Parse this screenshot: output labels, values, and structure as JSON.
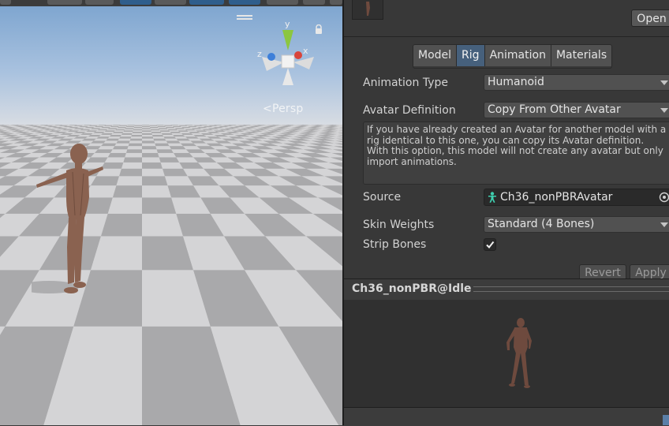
{
  "scene": {
    "camera_mode": "Persp",
    "gizmo_axes": {
      "y": "y",
      "x": "x",
      "z": "z"
    },
    "colors": {
      "axis_x": "#d9443a",
      "axis_y": "#8cc63f",
      "axis_z": "#3d7fd9"
    }
  },
  "inspector": {
    "open_button": "Open",
    "tabs": [
      {
        "label": "Model",
        "active": false
      },
      {
        "label": "Rig",
        "active": true
      },
      {
        "label": "Animation",
        "active": false
      },
      {
        "label": "Materials",
        "active": false
      }
    ],
    "animation_type": {
      "label": "Animation Type",
      "value": "Humanoid"
    },
    "avatar_definition": {
      "label": "Avatar Definition",
      "value": "Copy From Other Avatar"
    },
    "help_text": "If you have already created an Avatar for another model with a rig identical to this one, you can copy its Avatar definition.\nWith this option, this model will not create any avatar but only import animations.",
    "source": {
      "label": "Source",
      "value": "Ch36_nonPBRAvatar",
      "icon": "avatar-icon"
    },
    "skin_weights": {
      "label": "Skin Weights",
      "value": "Standard (4 Bones)"
    },
    "strip_bones": {
      "label": "Strip Bones",
      "checked": true
    },
    "revert_button": "Revert",
    "apply_button": "Apply",
    "preview_title": "Ch36_nonPBR@Idle",
    "colors": {
      "active_tab": "#46607c",
      "avatar_icon": "#3fd0b0"
    }
  }
}
